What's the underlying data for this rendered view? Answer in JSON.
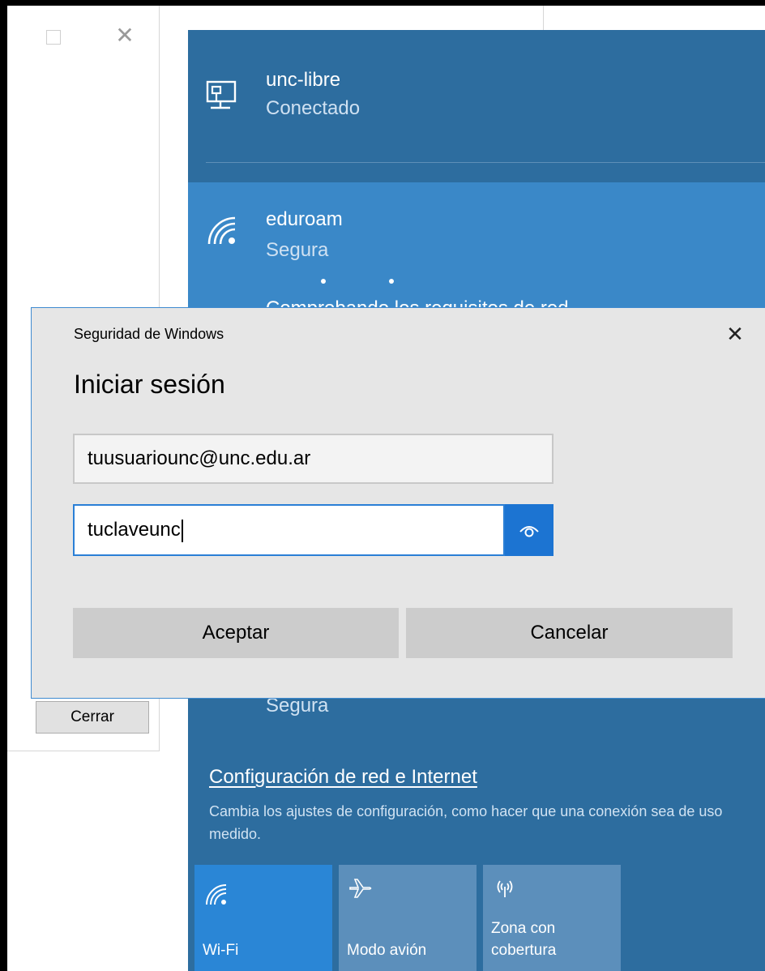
{
  "background_window": {
    "close_label": "Cerrar"
  },
  "network_flyout": {
    "networks": [
      {
        "name": "unc-libre",
        "status": "Conectado",
        "icon": "ethernet-icon"
      },
      {
        "name": "eduroam",
        "status": "Segura",
        "icon": "wifi-icon",
        "progress_text": "Comprobando los requisitos de red"
      },
      {
        "status": "Segura"
      }
    ],
    "settings_link": "Configuración de red e Internet",
    "settings_description": "Cambia los ajustes de configuración, como hacer que una conexión sea de uso medido.",
    "tiles": [
      {
        "label": "Wi-Fi",
        "icon": "wifi-icon",
        "active": true
      },
      {
        "label": "Modo avión",
        "icon": "airplane-icon",
        "active": false
      },
      {
        "label": "Zona con cobertura",
        "icon": "hotspot-icon",
        "active": false
      }
    ],
    "colors": {
      "flyout_bg": "#2d6d9f",
      "selected_bg": "#3a88c8",
      "active_tile": "#2a86d6",
      "inactive_tile": "#5c8fbb"
    }
  },
  "dialog": {
    "window_title": "Seguridad de Windows",
    "heading": "Iniciar sesión",
    "username_value": "tuusuariounc@unc.edu.ar",
    "password_value": "tuclaveunc",
    "ok_label": "Aceptar",
    "cancel_label": "Cancelar",
    "accent_color": "#1c74d2"
  }
}
